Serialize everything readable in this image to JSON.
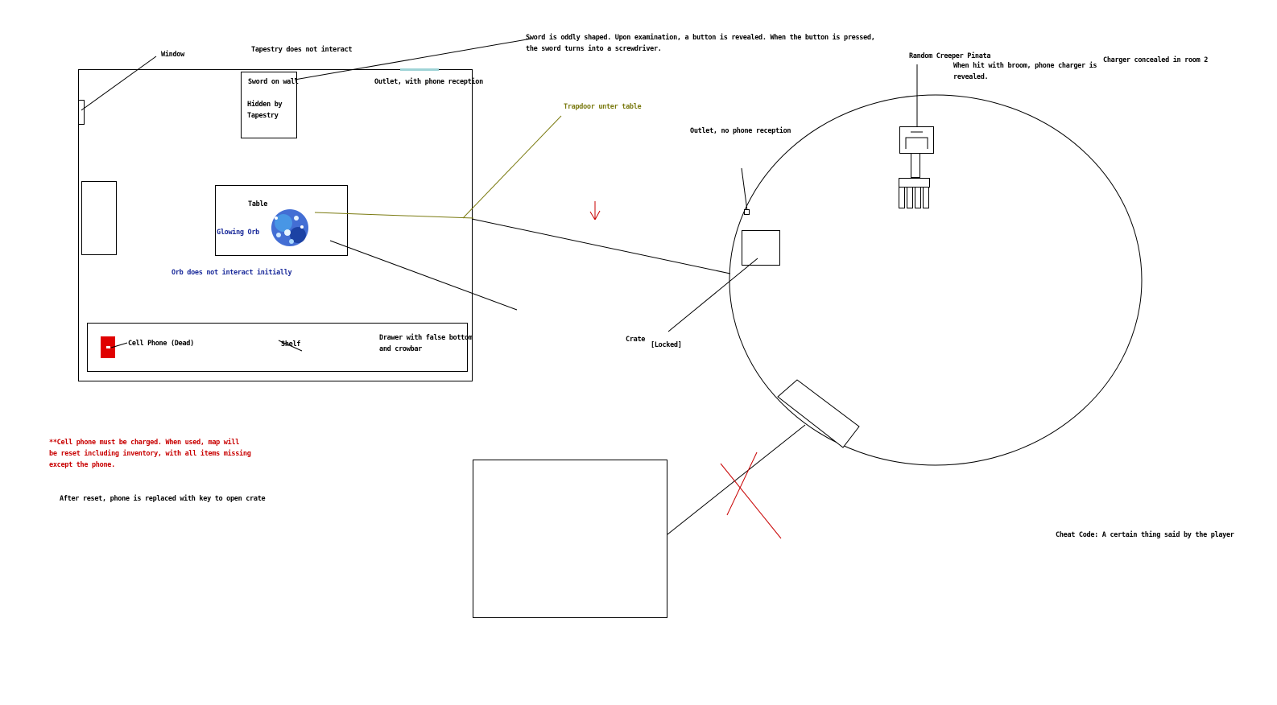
{
  "labels": {
    "window": "Window",
    "tapestry_note": "Tapestry does not interact",
    "sword_note": "Sword is oddly shaped. Upon examination, a button is revealed. When the button is pressed,\nthe sword turns into a screwdriver.",
    "sword_on_wall": "Sword on wall",
    "hidden_by_tapestry": "Hidden by\nTapestry",
    "outlet_reception": "Outlet, with phone reception",
    "trapdoor": "Trapdoor unter table",
    "table": "Table",
    "glowing_orb": "Glowing Orb",
    "orb_note": "Orb does not interact initially",
    "cell_phone": "Cell Phone (Dead)",
    "shelf": "Shelf",
    "drawer": "Drawer with false bottom\nand crowbar",
    "outlet_no_reception": "Outlet, no phone reception",
    "creeper": "Random Creeper Pinata",
    "creeper_note": "When hit with broom, phone charger is\nrevealed.",
    "charger_note": "Charger concealed in room 2",
    "crate": "Crate",
    "locked": "[Locked]",
    "phone_note": "**Cell phone must be charged. When used, map will\nbe reset including inventory, with all items missing\nexcept the phone.",
    "reset_note": "After reset, phone is replaced with key to open crate",
    "cheat_code": "Cheat Code: A certain thing said by the player"
  },
  "colors": {
    "ink": "#000000",
    "red": "#c80000",
    "blue_text": "#1a2a9a",
    "olive": "#7a7a10",
    "phone_red": "#e00000",
    "orb_blue": "#2255cc",
    "outlet_teal": "#9fd3d6"
  }
}
